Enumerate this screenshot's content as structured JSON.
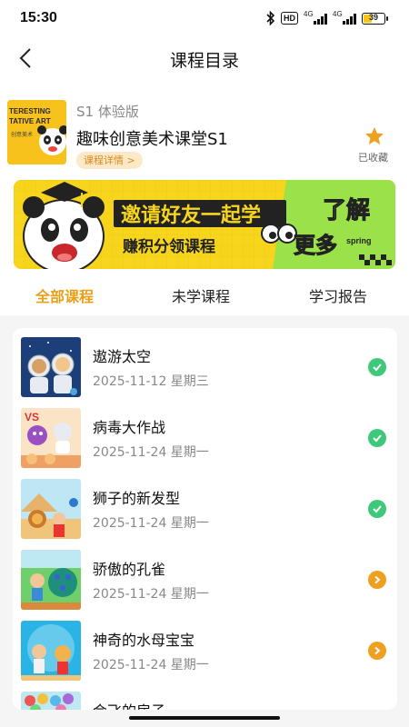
{
  "status_bar": {
    "time": "15:30",
    "hd": "HD",
    "net1": "4G",
    "net2": "4G",
    "battery": "39",
    "battery_level": 0.39
  },
  "nav": {
    "title": "课程目录"
  },
  "course": {
    "version": "S1 体验版",
    "title": "趣味创意美术课堂S1",
    "detail_label": "课程详情 >",
    "fav_label": "已收藏",
    "cover_text_1": "TERESTING",
    "cover_text_2": "TATIVE ART",
    "cover_text_3": "创意美术"
  },
  "banner": {
    "headline": "邀请好友一起学",
    "subline": "赚积分领课程",
    "cta_1": "了解",
    "cta_2": "更多",
    "tag": "spring"
  },
  "tabs": [
    {
      "label": "全部课程",
      "active": true
    },
    {
      "label": "未学课程",
      "active": false
    },
    {
      "label": "学习报告",
      "active": false
    }
  ],
  "lessons": [
    {
      "name": "遨游太空",
      "date": "2025-11-12 星期三",
      "status": "done"
    },
    {
      "name": "病毒大作战",
      "date": "2025-11-24 星期一",
      "status": "done"
    },
    {
      "name": "狮子的新发型",
      "date": "2025-11-24 星期一",
      "status": "done"
    },
    {
      "name": "骄傲的孔雀",
      "date": "2025-11-24 星期一",
      "status": "todo"
    },
    {
      "name": "神奇的水母宝宝",
      "date": "2025-11-24 星期一",
      "status": "todo"
    },
    {
      "name": "会飞的房子",
      "date": "",
      "status": ""
    }
  ],
  "colors": {
    "accent": "#e8a019",
    "done": "#3ec97a",
    "todo": "#f0a020",
    "banner_bg": "#f7d51d",
    "banner_green": "#9be24a"
  }
}
